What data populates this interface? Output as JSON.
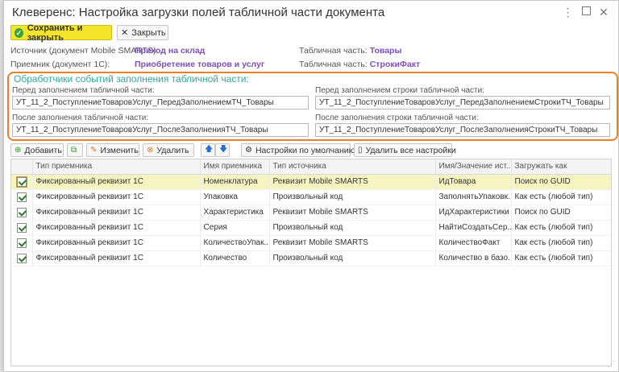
{
  "window": {
    "title": "Клеверенс: Настройка загрузки полей табличной части документа"
  },
  "toolbar": {
    "save_label": "Сохранить и закрыть",
    "close_label": "Закрыть"
  },
  "fields": {
    "source_label": "Источник (документ Mobile SMARTS):",
    "source_value": "Приход на склад",
    "receiver_label": "Приемник (документ 1С):",
    "receiver_value": "Приобретение товаров и услуг",
    "table_part_label_1": "Табличная часть:",
    "table_part_value_1": "Товары",
    "table_part_label_2": "Табличная часть:",
    "table_part_value_2": "СтрокиФакт"
  },
  "handlers": {
    "title": "Обработчики событий заполнения табличной части:",
    "before_table_label": "Перед заполнением табличной части:",
    "before_table_value": "УТ_11_2_ПоступлениеТоваровУслуг_ПередЗаполнениемТЧ_Товары",
    "before_row_label": "Перед заполнением строки табличной части:",
    "before_row_value": "УТ_11_2_ПоступлениеТоваровУслуг_ПередЗаполнениемСтрокиТЧ_Товары",
    "after_table_label": "После заполнения табличной части:",
    "after_table_value": "УТ_11_2_ПоступлениеТоваровУслуг_ПослеЗаполненияТЧ_Товары",
    "after_row_label": "После заполнения строки табличной части:",
    "after_row_value": "УТ_11_2_ПоступлениеТоваровУслуг_ПослеЗаполненияСтрокиТЧ_Товары"
  },
  "grid_toolbar": {
    "add_label": "Добавить",
    "edit_label": "Изменить",
    "delete_label": "Удалить",
    "defaults_label": "Настройки по умолчанию",
    "delete_all_label": "Удалить все настройки"
  },
  "table": {
    "columns": [
      "Тип приемника",
      "Имя приемника",
      "Тип источника",
      "Имя/Значение ист...",
      "Загружать как"
    ],
    "rows": [
      {
        "type": "Фиксированный реквизит 1С",
        "name": "Номенклатура",
        "source_type": "Реквизит Mobile SMARTS",
        "source_name": "ИдТовара",
        "load_as": "Поиск по GUID"
      },
      {
        "type": "Фиксированный реквизит 1С",
        "name": "Упаковка",
        "source_type": "Произвольный код",
        "source_name": "ЗаполнятьУпаковк...",
        "load_as": "Как есть (любой тип)"
      },
      {
        "type": "Фиксированный реквизит 1С",
        "name": "Характеристика",
        "source_type": "Реквизит Mobile SMARTS",
        "source_name": "ИдХарактеристики",
        "load_as": "Поиск по GUID"
      },
      {
        "type": "Фиксированный реквизит 1С",
        "name": "Серия",
        "source_type": "Произвольный код",
        "source_name": "НайтиСоздатьСер...",
        "load_as": "Как есть (любой тип)"
      },
      {
        "type": "Фиксированный реквизит 1С",
        "name": "КоличествоУпак...",
        "source_type": "Реквизит Mobile SMARTS",
        "source_name": "КоличествоФакт",
        "load_as": "Как есть (любой тип)"
      },
      {
        "type": "Фиксированный реквизит 1С",
        "name": "Количество",
        "source_type": "Произвольный код",
        "source_name": "Количество в базо...",
        "load_as": "Как есть (любой тип)"
      }
    ]
  }
}
